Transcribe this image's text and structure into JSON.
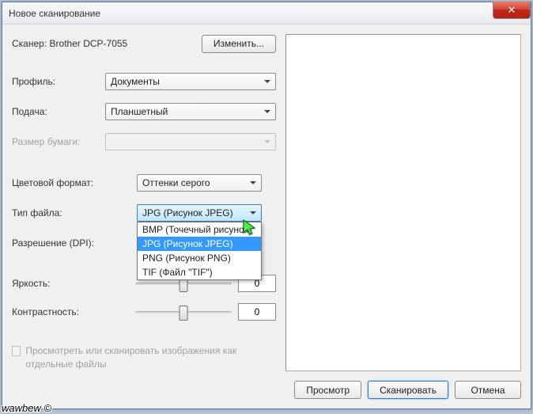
{
  "title": "Новое сканирование",
  "scanner": {
    "label": "Сканер:",
    "name": "Brother DCP-7055",
    "change": "Изменить..."
  },
  "profile": {
    "label": "Профиль:",
    "value": "Документы"
  },
  "feed": {
    "label": "Подача:",
    "value": "Планшетный"
  },
  "paper": {
    "label": "Размер бумаги:"
  },
  "color": {
    "label": "Цветовой формат:",
    "value": "Оттенки серого"
  },
  "filetype": {
    "label": "Тип файла:",
    "value": "JPG (Рисунок JPEG)",
    "options": {
      "bmp": "BMP (Точечный рисунок)",
      "jpg": "JPG (Рисунок JPEG)",
      "png": "PNG (Рисунок PNG)",
      "tif": "TIF (Файл \"TIF\")"
    }
  },
  "dpi": {
    "label": "Разрешение (DPI):"
  },
  "brightness": {
    "label": "Яркость:",
    "value": "0"
  },
  "contrast": {
    "label": "Контрастность:",
    "value": "0"
  },
  "separate": {
    "label": "Просмотреть или сканировать изображения как отдельные файлы"
  },
  "buttons": {
    "preview": "Просмотр",
    "scan": "Сканировать",
    "cancel": "Отмена"
  },
  "watermark": "wawbew ©"
}
